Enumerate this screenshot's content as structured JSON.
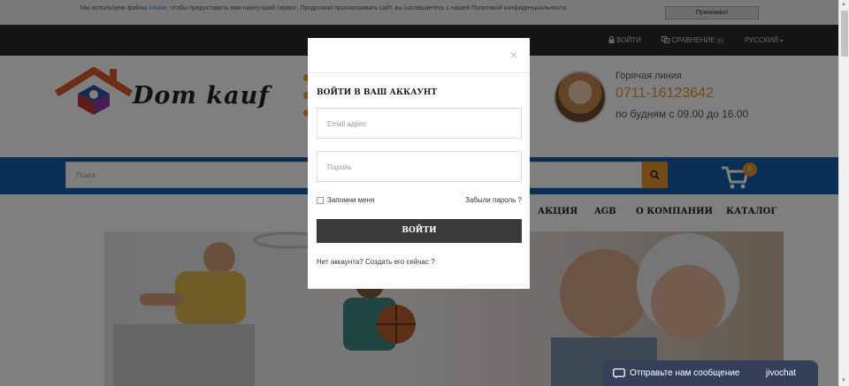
{
  "cookie_bar": {
    "text_before": "Мы используем файлы ",
    "link": "cookie",
    "text_after": ", чтобы предоставить вам наилучший сервис. Продолжая просматривать сайт, вы соглашаетесь с нашей Политикой конфиденциальности",
    "accept_label": "Принимаю!"
  },
  "topbar": {
    "login_label": "ВОЙТИ",
    "compare_label": "СРАВНЕНИЕ",
    "compare_count": "(0)",
    "language": "РУССКИЙ"
  },
  "header": {
    "logo_text": "Dom kauf",
    "hotline_label": "Горячая линия",
    "hotline_phone": "0711-16123642",
    "hotline_hours": "по будням с 09.00 до 16.00"
  },
  "search": {
    "placeholder": "Поиск"
  },
  "cart": {
    "count": "0"
  },
  "nav": {
    "items": [
      "АКЦИЯ",
      "AGB",
      "О КОМПАНИИ",
      "КАТАЛОГ"
    ]
  },
  "modal": {
    "close": "×",
    "title": "ВОЙТИ В ВАШ АККАУНТ",
    "email_placeholder": "Email адрес",
    "password_placeholder": "Пароль",
    "remember_label": "Запомни меня",
    "forgot_label": "Забыли пароль ?",
    "login_button": "ВОЙТИ",
    "no_account": "Нет аккаунта? Создать его сейчас ?"
  },
  "chat": {
    "message": "Отправьте нам сообщение",
    "brand": "jivochat"
  },
  "colors": {
    "accent": "#e8962a",
    "brand_blue": "#1261a8",
    "dark_bar": "#2b2b2b",
    "chat_bg": "#34405a"
  }
}
